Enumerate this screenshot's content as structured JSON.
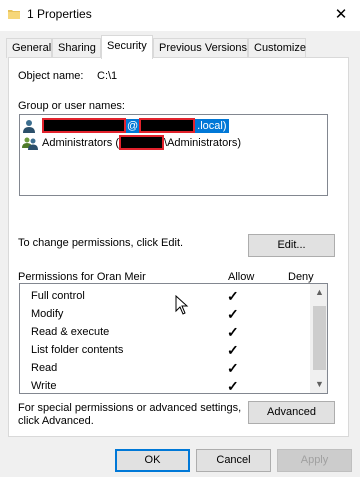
{
  "window": {
    "title": "1 Properties",
    "close_glyph": "✕"
  },
  "tabs": [
    {
      "label": "General",
      "active": false
    },
    {
      "label": "Sharing",
      "active": false
    },
    {
      "label": "Security",
      "active": true
    },
    {
      "label": "Previous Versions",
      "active": false
    },
    {
      "label": "Customize",
      "active": false
    }
  ],
  "security": {
    "object_name_label": "Object name:",
    "object_name_value": "C:\\1",
    "group_label": "Group or user names:",
    "users": [
      {
        "prefix": "",
        "middle": "@",
        "suffix": ".local)",
        "selected": true,
        "icon": "user-icon"
      },
      {
        "prefix": "Administrators (",
        "middle": "",
        "suffix": "\\Administrators)",
        "selected": false,
        "icon": "group-icon"
      }
    ],
    "change_text": "To change permissions, click Edit.",
    "edit_button": "Edit...",
    "permissions_for": "Permissions for Oran Meir",
    "allow_header": "Allow",
    "deny_header": "Deny",
    "permissions": [
      {
        "name": "Full control",
        "allow": "✓"
      },
      {
        "name": "Modify",
        "allow": "✓"
      },
      {
        "name": "Read & execute",
        "allow": "✓"
      },
      {
        "name": "List folder contents",
        "allow": "✓"
      },
      {
        "name": "Read",
        "allow": "✓"
      },
      {
        "name": "Write",
        "allow": "✓"
      }
    ],
    "special_text_1": "For special permissions or advanced settings,",
    "special_text_2": "click Advanced.",
    "advanced_button": "Advanced"
  },
  "footer": {
    "ok": "OK",
    "cancel": "Cancel",
    "apply": "Apply"
  },
  "colors": {
    "accent": "#0078d7",
    "selection": "#cce8ff",
    "redaction_border": "#e2222c"
  }
}
